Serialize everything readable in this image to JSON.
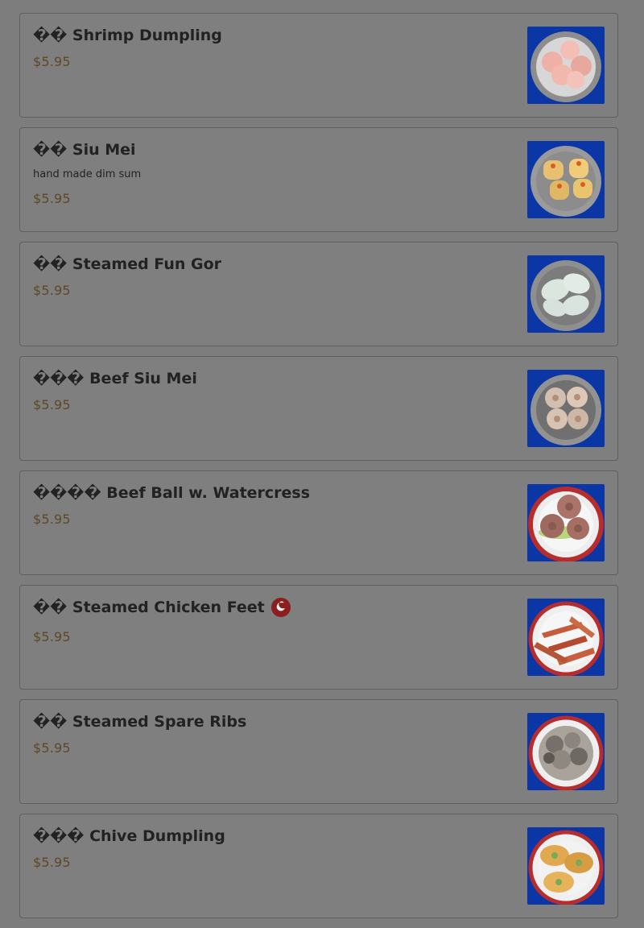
{
  "menu": {
    "items": [
      {
        "name": "�� Shrimp Dumpling",
        "description": "",
        "price": "$5.95",
        "spicy": false,
        "image": "shrimp-dumpling-photo"
      },
      {
        "name": "�� Siu Mei",
        "description": "hand made dim sum",
        "price": "$5.95",
        "spicy": false,
        "image": "siu-mei-photo"
      },
      {
        "name": "�� Steamed Fun Gor",
        "description": "",
        "price": "$5.95",
        "spicy": false,
        "image": "fun-gor-photo"
      },
      {
        "name": "��� Beef Siu Mei",
        "description": "",
        "price": "$5.95",
        "spicy": false,
        "image": "beef-siu-mei-photo"
      },
      {
        "name": "���� Beef Ball w. Watercress",
        "description": "",
        "price": "$5.95",
        "spicy": false,
        "image": "beef-ball-photo"
      },
      {
        "name": "�� Steamed Chicken Feet",
        "description": "",
        "price": "$5.95",
        "spicy": true,
        "image": "chicken-feet-photo"
      },
      {
        "name": "�� Steamed Spare Ribs",
        "description": "",
        "price": "$5.95",
        "spicy": false,
        "image": "spare-ribs-photo"
      },
      {
        "name": "��� Chive Dumpling",
        "description": "",
        "price": "$5.95",
        "spicy": false,
        "image": "chive-dumpling-photo"
      }
    ],
    "colors": {
      "overlay_background": "#7d7d7d",
      "card_background": "#7f7f7f",
      "title": "#222222",
      "price": "#5f4824",
      "spicy_badge": "#8b1f1f"
    }
  }
}
